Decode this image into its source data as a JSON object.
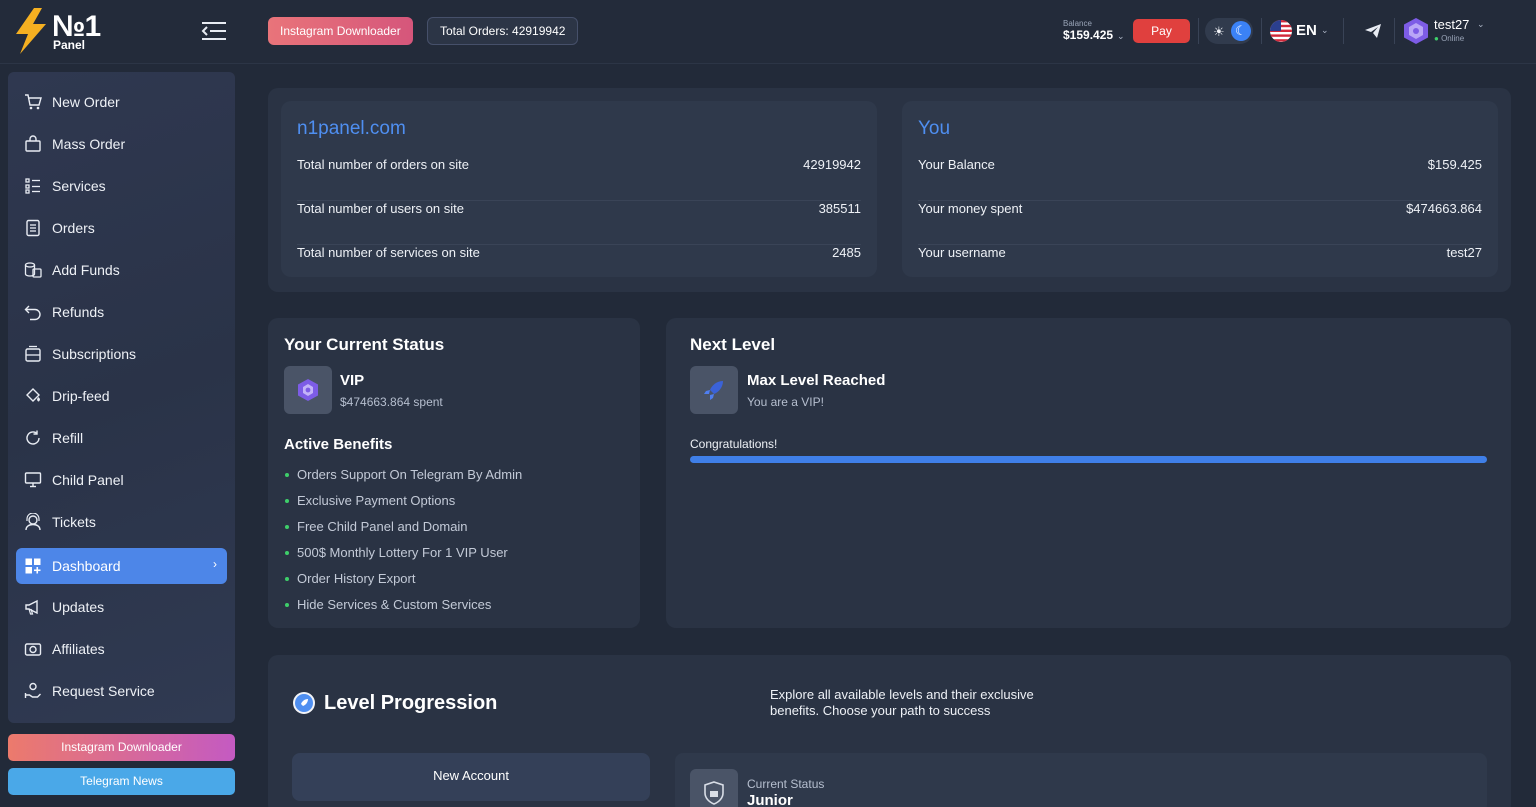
{
  "brand": {
    "number": "№1",
    "name": "Panel"
  },
  "topbar": {
    "insta_label": "Instagram Downloader",
    "orders_label": "Total Orders: 42919942",
    "balance_label": "Balance",
    "balance_value": "$159.425",
    "pay_label": "Pay",
    "lang_label": "EN",
    "username": "test27",
    "user_status": "Online"
  },
  "sidebar": {
    "items": [
      {
        "label": "New Order"
      },
      {
        "label": "Mass Order"
      },
      {
        "label": "Services"
      },
      {
        "label": "Orders"
      },
      {
        "label": "Add Funds"
      },
      {
        "label": "Refunds"
      },
      {
        "label": "Subscriptions"
      },
      {
        "label": "Drip-feed"
      },
      {
        "label": "Refill"
      },
      {
        "label": "Child Panel"
      },
      {
        "label": "Tickets"
      },
      {
        "label": "Dashboard"
      },
      {
        "label": "Updates"
      },
      {
        "label": "Affiliates"
      },
      {
        "label": "Request Service"
      }
    ],
    "active_index": 11,
    "insta_button": "Instagram Downloader",
    "telegram_button": "Telegram News"
  },
  "site_stats": {
    "title": "n1panel.com",
    "rows": [
      {
        "label": "Total number of orders on site",
        "value": "42919942"
      },
      {
        "label": "Total number of users on site",
        "value": "385511"
      },
      {
        "label": "Total number of services on site",
        "value": "2485"
      }
    ]
  },
  "you_stats": {
    "title": "You",
    "rows": [
      {
        "label": "Your Balance",
        "value": "$159.425"
      },
      {
        "label": "Your money spent",
        "value": "$474663.864"
      },
      {
        "label": "Your username",
        "value": "test27"
      }
    ]
  },
  "current_status": {
    "title": "Your Current Status",
    "level": "VIP",
    "spent": "$474663.864 spent",
    "benefits_title": "Active Benefits",
    "benefits": [
      "Orders Support On Telegram By Admin",
      "Exclusive Payment Options",
      "Free Child Panel and Domain",
      "500$ Monthly Lottery For 1 VIP User",
      "Order History Export",
      "Hide Services & Custom Services"
    ]
  },
  "next_level": {
    "title": "Next Level",
    "name": "Max Level Reached",
    "sub": "You are a VIP!",
    "message": "Congratulations!",
    "progress_fraction": 1.0
  },
  "level_progression": {
    "title": "Level Progression",
    "description": "Explore all available levels and their exclusive benefits. Choose your path to success",
    "new_account_label": "New Account",
    "current_status_label": "Current Status",
    "current_status_value": "Junior"
  },
  "colors": {
    "accent": "#4d86e8",
    "pay": "#e0403e",
    "link": "#4f8ff1",
    "bullet": "#3ecf6a"
  }
}
